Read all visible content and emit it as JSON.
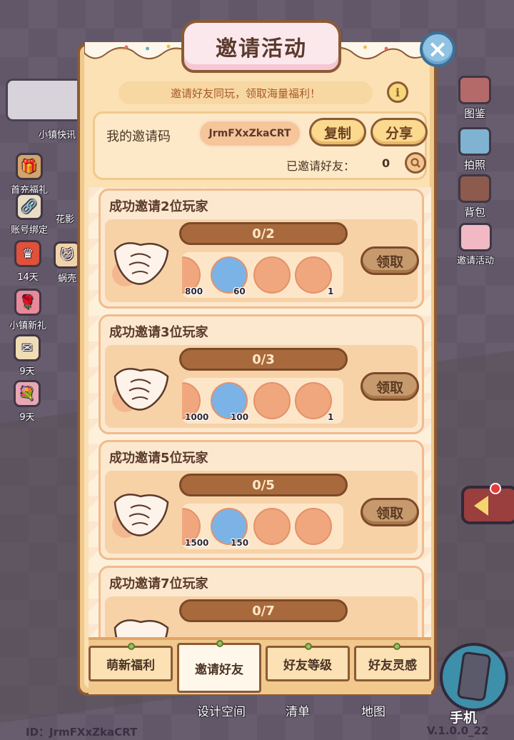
{
  "modal": {
    "title": "邀请活动",
    "close_label": "×",
    "banner": "邀请好友同玩，领取海量福利！",
    "info_label": "i",
    "code_label": "我的邀请码",
    "code_value": "JrmFXxZkaCRT",
    "copy_label": "复制",
    "share_label": "分享",
    "invited_label": "已邀请好友：",
    "invited_count": "0"
  },
  "cards": [
    {
      "title": "成功邀请2位玩家",
      "progress": "0/2",
      "claim_label": "领取",
      "rewards": [
        {
          "icon": "coin-icon",
          "qty": "800"
        },
        {
          "icon": "swirl-gem-icon",
          "qty": "60"
        },
        {
          "icon": "desk-icon",
          "qty": ""
        },
        {
          "icon": "blueprint-icon",
          "qty": "1"
        }
      ]
    },
    {
      "title": "成功邀请3位玩家",
      "progress": "0/3",
      "claim_label": "领取",
      "rewards": [
        {
          "icon": "coin-icon",
          "qty": "1000"
        },
        {
          "icon": "swirl-gem-icon",
          "qty": "100"
        },
        {
          "icon": "cosmetic-box-icon",
          "qty": ""
        },
        {
          "icon": "blueprint-icon",
          "qty": "1"
        }
      ]
    },
    {
      "title": "成功邀请5位玩家",
      "progress": "0/5",
      "claim_label": "领取",
      "rewards": [
        {
          "icon": "coin-icon",
          "qty": "1500"
        },
        {
          "icon": "swirl-gem-icon",
          "qty": "150"
        },
        {
          "icon": "bench-icon",
          "qty": ""
        },
        {
          "icon": "wooden-table-icon",
          "qty": ""
        }
      ]
    },
    {
      "title": "成功邀请7位玩家",
      "progress": "0/7",
      "claim_label": "",
      "rewards": []
    }
  ],
  "tabs": [
    {
      "label": "萌新福利",
      "active": false
    },
    {
      "label": "邀请好友",
      "active": true
    },
    {
      "label": "好友等级",
      "active": false
    },
    {
      "label": "好友灵感",
      "active": false
    }
  ],
  "left_menu": [
    {
      "label": "小镇快讯",
      "icon": "news-icon"
    },
    {
      "label": "首充福礼",
      "icon": "gift-box-icon"
    },
    {
      "label": "账号绑定",
      "icon": "link-icon"
    },
    {
      "label": "花影",
      "icon": "flower-icon"
    },
    {
      "label": "14天",
      "icon": "crown-icon"
    },
    {
      "label": "蜗壳",
      "icon": "cat-icon"
    },
    {
      "label": "小镇新礼",
      "icon": "rose-icon"
    },
    {
      "label": "9天",
      "icon": "letter-icon"
    },
    {
      "label": "9天",
      "icon": "bouquet-icon"
    }
  ],
  "right_menu": [
    {
      "label": "图鉴",
      "icon": "book-icon"
    },
    {
      "label": "拍照",
      "icon": "camera-icon"
    },
    {
      "label": "背包",
      "icon": "backpack-icon"
    },
    {
      "label": "邀请活动",
      "icon": "invite-letter-icon"
    }
  ],
  "bottom_nav": {
    "design": "设计空间",
    "list": "清单",
    "map": "地图",
    "phone": "手机"
  },
  "footer": {
    "id_text": "ID：JrmFXxZkaCRT",
    "version": "V.1.0.0_22"
  },
  "colors": {
    "panel": "#fbe1b3",
    "border": "#8c5a36",
    "progress": "#a86a3c",
    "close": "#8fc3e4"
  }
}
